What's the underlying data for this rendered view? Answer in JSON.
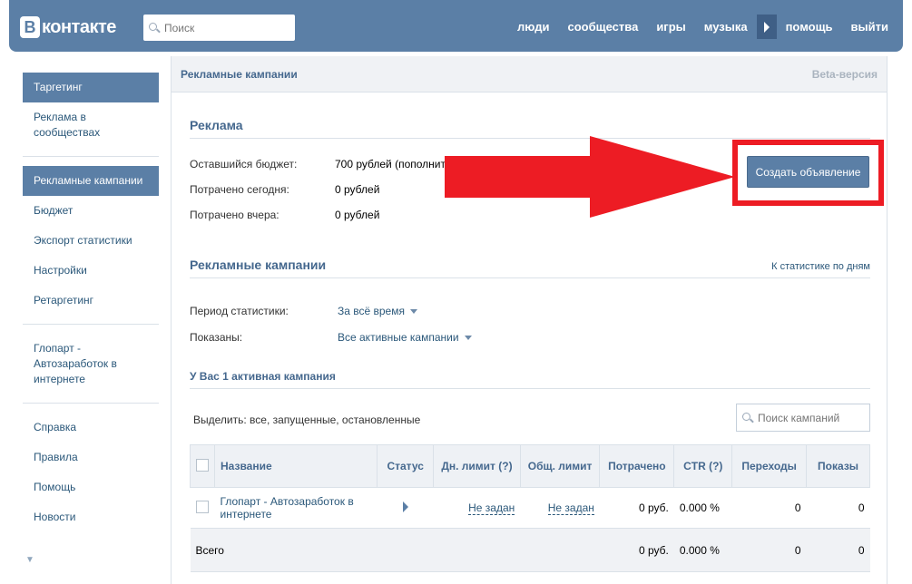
{
  "header": {
    "logo_letter": "В",
    "logo_text": "контакте",
    "search_placeholder": "Поиск",
    "nav": [
      "люди",
      "сообщества",
      "игры",
      "музыка",
      "помощь",
      "выйти"
    ]
  },
  "sidebar": {
    "group1": [
      "Таргетинг",
      "Реклама в сообществах"
    ],
    "group2": [
      "Рекламные кампании",
      "Бюджет",
      "Экспорт статистики",
      "Настройки",
      "Ретаргетинг"
    ],
    "group3": [
      "Глопарт - Автозаработок в интернете"
    ],
    "group4": [
      "Справка",
      "Правила",
      "Помощь",
      "Новости"
    ],
    "active": [
      "Таргетинг",
      "Рекламные кампании"
    ],
    "scroll_glyph": "▼"
  },
  "main": {
    "header_title": "Рекламные кампании",
    "beta": "Beta-версия",
    "ads": {
      "title": "Реклама",
      "rows": [
        {
          "label": "Оставшийся бюджет:",
          "value": "700 рублей (пополнить)"
        },
        {
          "label": "Потрачено сегодня:",
          "value": "0 рублей"
        },
        {
          "label": "Потрачено вчера:",
          "value": "0 рублей"
        }
      ],
      "create_button": "Создать объявление"
    },
    "campaigns": {
      "title": "Рекламные кампании",
      "stats_link": "К статистике по дням",
      "period_label": "Период статистики:",
      "period_value": "За всё время",
      "shown_label": "Показаны:",
      "shown_value": "Все активные кампании",
      "active_count_text": "У Вас 1 активная кампания",
      "select_text": "Выделить: все, запущенные, остановленные",
      "search_placeholder": "Поиск кампаний"
    },
    "table": {
      "columns": [
        "Название",
        "Статус",
        "Дн. лимит (?)",
        "Общ. лимит",
        "Потрачено",
        "CTR (?)",
        "Переходы",
        "Показы"
      ],
      "rows": [
        {
          "name": "Глопарт - Автозаработок в интернете",
          "day_limit": "Не задан",
          "total_limit": "Не задан",
          "spent": "0 руб.",
          "ctr": "0.000 %",
          "clicks": "0",
          "views": "0"
        }
      ],
      "total": {
        "label": "Всего",
        "spent": "0 руб.",
        "ctr": "0.000 %",
        "clicks": "0",
        "views": "0"
      }
    }
  },
  "colors": {
    "brand": "#5b7fa6",
    "highlight": "#ed1c24",
    "link": "#2b587a"
  }
}
